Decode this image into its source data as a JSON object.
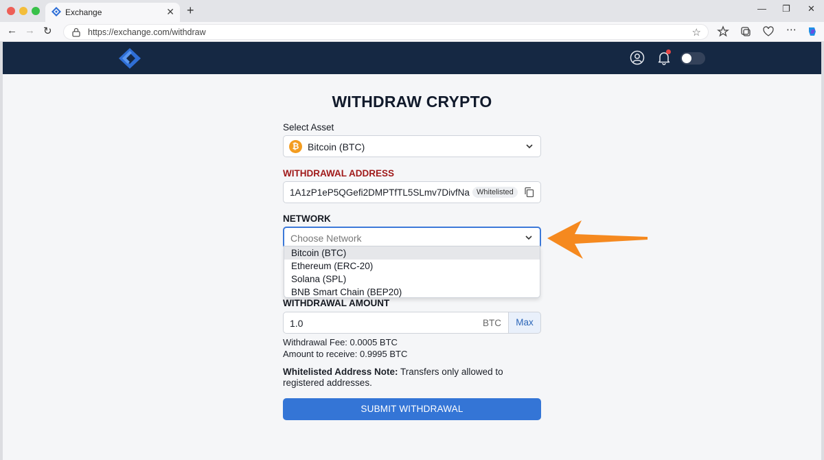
{
  "browser": {
    "tab_title": "Exchange",
    "tab_close": "✕",
    "new_tab": "+",
    "url": "https://exchange.com/withdraw"
  },
  "page": {
    "title": "WITHDRAW CRYPTO",
    "asset": {
      "label": "Select Asset",
      "value": "Bitcoin (BTC)",
      "icon_glyph": "₿"
    },
    "address": {
      "label": "WITHDRAWAL ADDRESS",
      "value": "1A1zP1eP5QGefi2DMPTfTL5SLmv7DivfNa",
      "badge": "Whitelisted"
    },
    "network": {
      "label": "NETWORK",
      "placeholder": "Choose Network",
      "options": [
        "Bitcoin (BTC)",
        "Ethereum (ERC-20)",
        "Solana (SPL)",
        "BNB Smart Chain (BEP20)"
      ],
      "highlighted_option": "Bitcoin (BTC)"
    },
    "amount": {
      "label": "WITHDRAWAL AMOUNT",
      "value": "1.0",
      "unit": "BTC",
      "max_label": "Max"
    },
    "fee_text": "Withdrawal Fee: 0.0005 BTC",
    "receive_text": "Amount to receive: 0.9995 BTC",
    "note": {
      "title": "Whitelisted Address Note:",
      "text": "Transfers only allowed to registered addresses."
    },
    "submit_label": "SUBMIT WITHDRAWAL"
  },
  "colors": {
    "header_bg": "#152843",
    "accent": "#3475d6",
    "address_label": "#a01a1a",
    "annotation_arrow": "#f5891f"
  },
  "icons": [
    "logo-icon",
    "user-icon",
    "bell-icon",
    "theme-toggle",
    "bitcoin-icon",
    "copy-icon",
    "chevron-down-icon",
    "annotation-arrow"
  ]
}
